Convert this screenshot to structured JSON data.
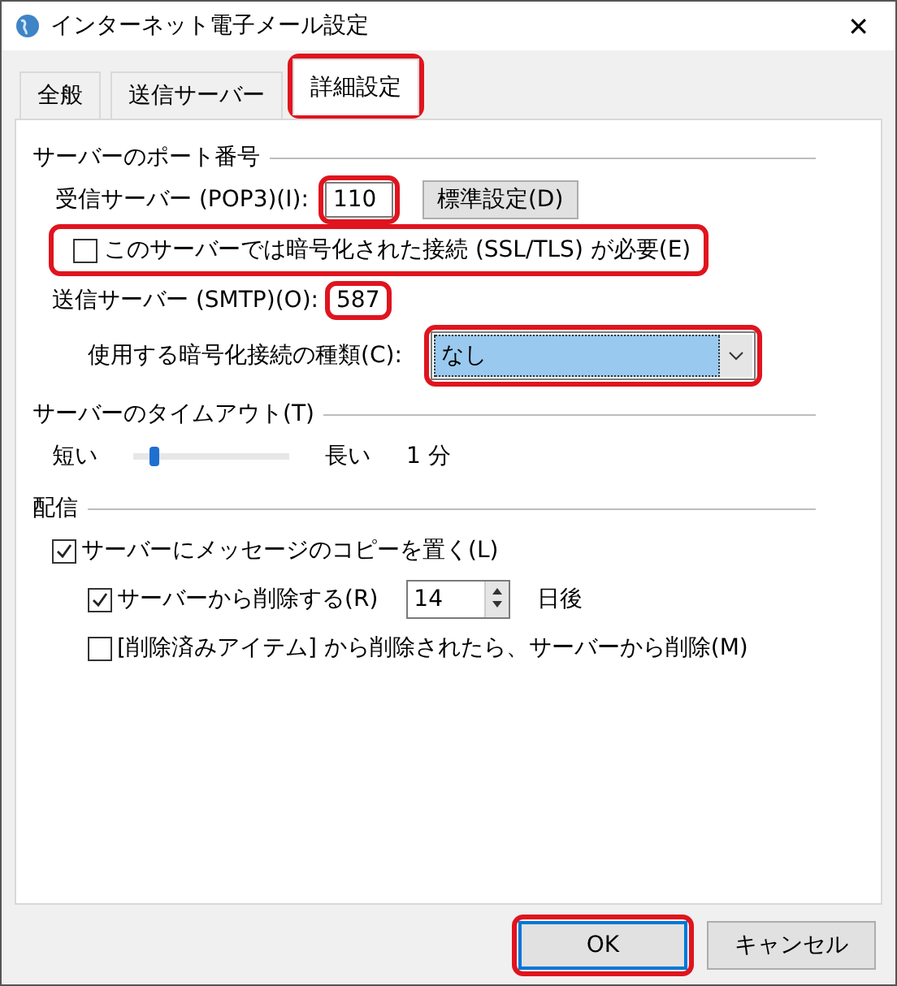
{
  "window": {
    "title": "インターネット電子メール設定",
    "close": "✕"
  },
  "tabs": [
    {
      "label": "全般",
      "selected": false,
      "highlighted": false
    },
    {
      "label": "送信サーバー",
      "selected": false,
      "highlighted": false
    },
    {
      "label": "詳細設定",
      "selected": true,
      "highlighted": true
    }
  ],
  "ports": {
    "heading": "サーバーのポート番号",
    "incoming": {
      "label": "受信サーバー (POP3)(I):",
      "value": "110",
      "highlighted": true
    },
    "default_button": "標準設定(D)",
    "ssl": {
      "label": "このサーバーでは暗号化された接続 (SSL/TLS) が必要(E)",
      "checked": false,
      "highlighted": true
    },
    "outgoing": {
      "label": "送信サーバー (SMTP)(O):",
      "value": "587",
      "highlighted": true
    },
    "encryption": {
      "label": "使用する暗号化接続の種類(C):",
      "value": "なし",
      "highlighted": true
    }
  },
  "timeout": {
    "heading": "サーバーのタイムアウト(T)",
    "short_label": "短い",
    "long_label": "長い",
    "level": 0.1,
    "reading": "1 分"
  },
  "delivery": {
    "heading": "配信",
    "leave_copy": {
      "label": "サーバーにメッセージのコピーを置く(L)",
      "checked": true
    },
    "remove_after": {
      "label": "サーバーから削除する(R)",
      "checked": true,
      "days": "14",
      "unit": "日後"
    },
    "remove_deleted": {
      "label": "[削除済みアイテム] から削除されたら、サーバーから削除(M)",
      "checked": false
    }
  },
  "buttons": [
    {
      "label": "OK",
      "focused": true,
      "highlighted": true
    },
    {
      "label": "キャンセル",
      "focused": false,
      "highlighted": false
    }
  ]
}
